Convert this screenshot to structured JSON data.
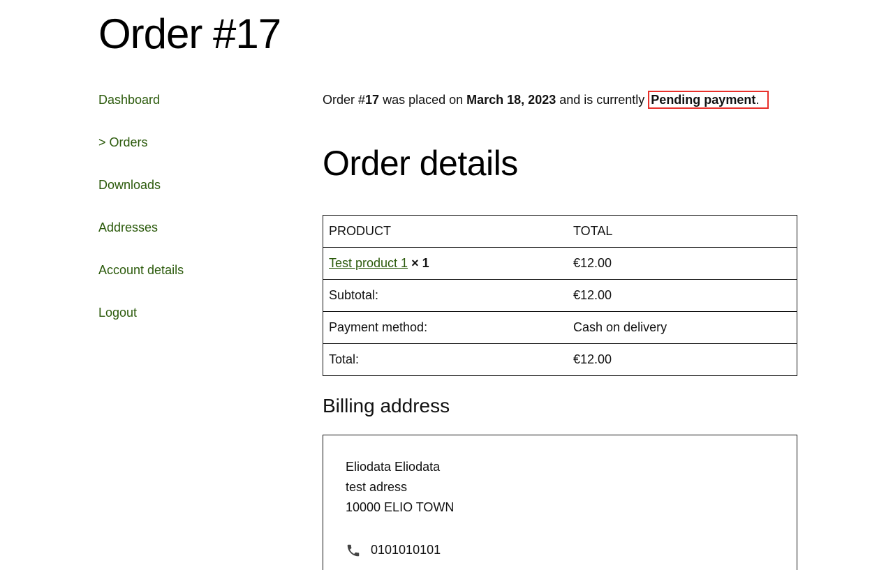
{
  "page": {
    "title": "Order #17"
  },
  "sidebar": {
    "items": [
      {
        "label": "Dashboard"
      },
      {
        "label": "> Orders"
      },
      {
        "label": "Downloads"
      },
      {
        "label": "Addresses"
      },
      {
        "label": "Account details"
      },
      {
        "label": "Logout"
      }
    ]
  },
  "summary": {
    "prefix": "Order #",
    "order_number": "17",
    "placed_text": " was placed on ",
    "date": "March 18, 2023",
    "status_text": " and is currently ",
    "status": "Pending payment",
    "end": "."
  },
  "details": {
    "title": "Order details",
    "headers": {
      "product": "PRODUCT",
      "total": "TOTAL"
    },
    "product": {
      "name": "Test product 1",
      "qty": "× 1",
      "total": "€12.00"
    },
    "rows": [
      {
        "label": "Subtotal:",
        "value": "€12.00"
      },
      {
        "label": "Payment method:",
        "value": "Cash on delivery"
      },
      {
        "label": "Total:",
        "value": "€12.00"
      }
    ]
  },
  "billing": {
    "title": "Billing address",
    "name": "Eliodata Eliodata",
    "street": "test adress",
    "city": "10000 ELIO TOWN",
    "phone": "0101010101"
  },
  "colors": {
    "link": "#2b5a0b",
    "highlight": "#e8302a"
  },
  "icons": {
    "phone": "phone-icon"
  }
}
